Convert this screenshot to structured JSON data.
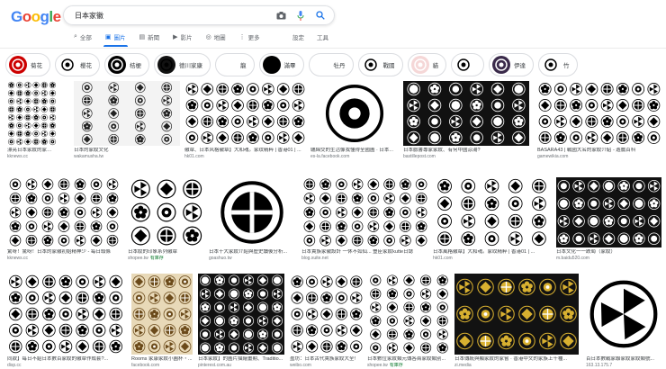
{
  "logo": {
    "letters": [
      "G",
      "o",
      "o",
      "g",
      "l",
      "e"
    ],
    "colors": [
      "#4285f4",
      "#ea4335",
      "#fbbc05",
      "#4285f4",
      "#34a853",
      "#ea4335"
    ]
  },
  "search": {
    "query": "日本家徽",
    "icons": [
      "camera-icon",
      "mic-icon",
      "search-icon"
    ]
  },
  "tabs": [
    {
      "label": "全部",
      "icon": "⌕"
    },
    {
      "label": "圖片",
      "icon": "▣",
      "active": true
    },
    {
      "label": "新聞",
      "icon": "▤"
    },
    {
      "label": "影片",
      "icon": "▶"
    },
    {
      "label": "地圖",
      "icon": "◎"
    },
    {
      "label": "更多",
      "icon": "⋮"
    }
  ],
  "tools": {
    "settings": "設定",
    "tools": "工具"
  },
  "chips": [
    "菊花",
    "櫻花",
    "桔梗",
    "德川家康",
    "龍",
    "滿畢",
    "牡丹",
    "戰國",
    "貓",
    "",
    "伊達",
    "竹"
  ],
  "results": [
    {
      "caption": "漂亮日本家紋的家徽圖案高清圖... 漢字, 日本...",
      "source": "kknews.cc"
    },
    {
      "caption": "日本的家紋文化",
      "source": "wakamusha.tw"
    },
    {
      "caption": "徽章、日本风格徽章】大和魂。家纹精粹 | 香港01 | ...",
      "source": "hk01.com"
    },
    {
      "caption": "纏綿交的生活像我懂得全國圖 · 日本...",
      "source": "es-la.facebook.com"
    },
    {
      "caption": "日本臉書專家家紋、有何中國涼湯?",
      "source": "bastillepost.com"
    },
    {
      "caption": "BASARA43 | 戰國大名的家紋介紹 - 遊戲百科",
      "source": "gamewikia.com"
    },
    {
      "caption": "驚呀！驚呀！日本的家徽初始精神少 - 每日頭條",
      "source": "kknews.cc"
    },
    {
      "caption": "日本紋的印象系列徽章",
      "source": "shopee.tw",
      "badge": "有庫存"
    },
    {
      "caption": "日本十大家紋介紹與歷史讀後分析...",
      "source": "goashuo.tw"
    },
    {
      "caption": "日本貴族家徽設計 一休不如仙... 豐臣家紋kutte日誌",
      "source": "blog.xuite.net"
    },
    {
      "caption": "日本風格徽章】大和魂。家纹精粹 | 香港01 | ...",
      "source": "hk01.com"
    },
    {
      "caption": "日本文化一一跌萄（家紋）",
      "source": "m.baidu520.com"
    },
    {
      "caption": "同款】每日不給日本數百家紋的徽章作成套?...",
      "source": "disp.cc"
    },
    {
      "caption": "Rooms 家康家紋小圓杯・...",
      "source": "facebook.com"
    },
    {
      "caption": "日本家紋】的圖片描繪畫期、Traditio...",
      "source": "pinterest.com.au"
    },
    {
      "caption": "盈坊：日本古代貴族家紋大全!",
      "source": "weibo.com"
    },
    {
      "caption": "日本數位家紋類元傳各兩家紋類別...",
      "source": "shopee.tw",
      "badge": "有庫存"
    },
    {
      "caption": "日本傳統與顯家紋的家嘗 · 香港中文的家族上千種...",
      "source": "zi.media"
    },
    {
      "caption": "百日本數戰家聯家紋家紋類號...",
      "source": "163.13.175.7"
    }
  ]
}
